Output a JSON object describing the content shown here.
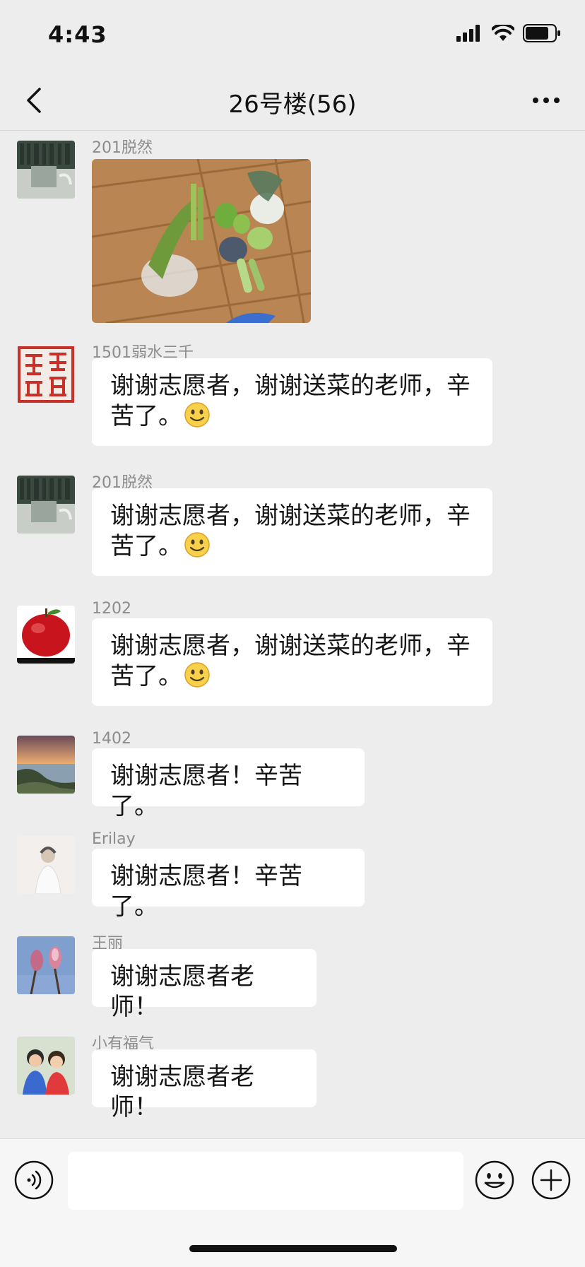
{
  "status_bar": {
    "time": "4:43",
    "signal_icon": "cellular-signal-icon",
    "wifi_icon": "wifi-icon",
    "battery_icon": "battery-icon"
  },
  "nav": {
    "title": "26号楼(56)",
    "back_icon": "chevron-left-icon",
    "more_icon": "more-dots-icon"
  },
  "messages": [
    {
      "sender": "201脱然",
      "type": "image",
      "avatar": "bookshelf-avatar",
      "image": "vegetables-photo"
    },
    {
      "sender": "1501弱水三千",
      "type": "text",
      "avatar": "red-seal-avatar",
      "line1": "谢谢志愿者，谢谢送菜的老师，辛",
      "line2": "苦了。",
      "emoji": "smiley-emoji"
    },
    {
      "sender": "201脱然",
      "type": "text",
      "avatar": "bookshelf-avatar",
      "line1": "谢谢志愿者，谢谢送菜的老师，辛",
      "line2": "苦了。",
      "emoji": "smiley-emoji"
    },
    {
      "sender": "1202",
      "type": "text",
      "avatar": "red-apple-avatar",
      "line1": "谢谢志愿者，谢谢送菜的老师，辛",
      "line2": "苦了。",
      "emoji": "smiley-emoji"
    },
    {
      "sender": "1402",
      "type": "text",
      "avatar": "sunset-coast-avatar",
      "text": "谢谢志愿者！辛苦了。"
    },
    {
      "sender": "Erilay",
      "type": "text",
      "avatar": "person-avatar",
      "text": "谢谢志愿者！辛苦了。"
    },
    {
      "sender": "王丽",
      "type": "text",
      "avatar": "magnolia-avatar",
      "text": "谢谢志愿者老师！"
    },
    {
      "sender": "小有福气",
      "type": "text",
      "avatar": "children-avatar",
      "text": "谢谢志愿者老师！"
    }
  ],
  "input_bar": {
    "voice_icon": "voice-icon",
    "input_placeholder": "",
    "emoji_icon": "emoji-icon",
    "plus_icon": "plus-icon"
  },
  "colors": {
    "background": "#ededed",
    "bubble": "#ffffff",
    "sender_name": "#8c8c8c"
  }
}
